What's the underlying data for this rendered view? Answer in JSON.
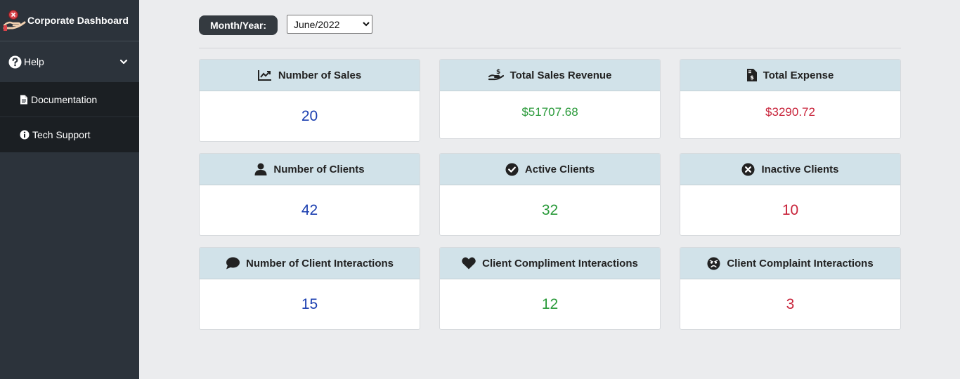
{
  "sidebar": {
    "brand_title": "Corporate Dashboard",
    "help_label": "Help",
    "items": [
      {
        "label": "Documentation",
        "icon": "document-icon"
      },
      {
        "label": "Tech Support",
        "icon": "info-icon"
      }
    ]
  },
  "filter": {
    "label": "Month/Year:",
    "selected": "June/2022"
  },
  "cards": [
    {
      "title": "Number of Sales",
      "value": "20",
      "icon": "chart-line-icon",
      "color": "#1b3fb0"
    },
    {
      "title": "Total Sales Revenue",
      "value": "$51707.68",
      "icon": "hand-dollar-icon",
      "color": "#2a9a3a"
    },
    {
      "title": "Total Expense",
      "value": "$3290.72",
      "icon": "invoice-dollar-icon",
      "color": "#c8233a"
    },
    {
      "title": "Number of Clients",
      "value": "42",
      "icon": "user-icon",
      "color": "#1b3fb0"
    },
    {
      "title": "Active Clients",
      "value": "32",
      "icon": "check-circle-icon",
      "color": "#2a9a3a"
    },
    {
      "title": "Inactive Clients",
      "value": "10",
      "icon": "x-circle-icon",
      "color": "#c8233a"
    },
    {
      "title": "Number of Client Interactions",
      "value": "15",
      "icon": "comment-icon",
      "color": "#1b3fb0"
    },
    {
      "title": "Client Compliment Interactions",
      "value": "12",
      "icon": "heart-icon",
      "color": "#2a9a3a"
    },
    {
      "title": "Client Complaint Interactions",
      "value": "3",
      "icon": "angry-face-icon",
      "color": "#c8233a"
    }
  ]
}
